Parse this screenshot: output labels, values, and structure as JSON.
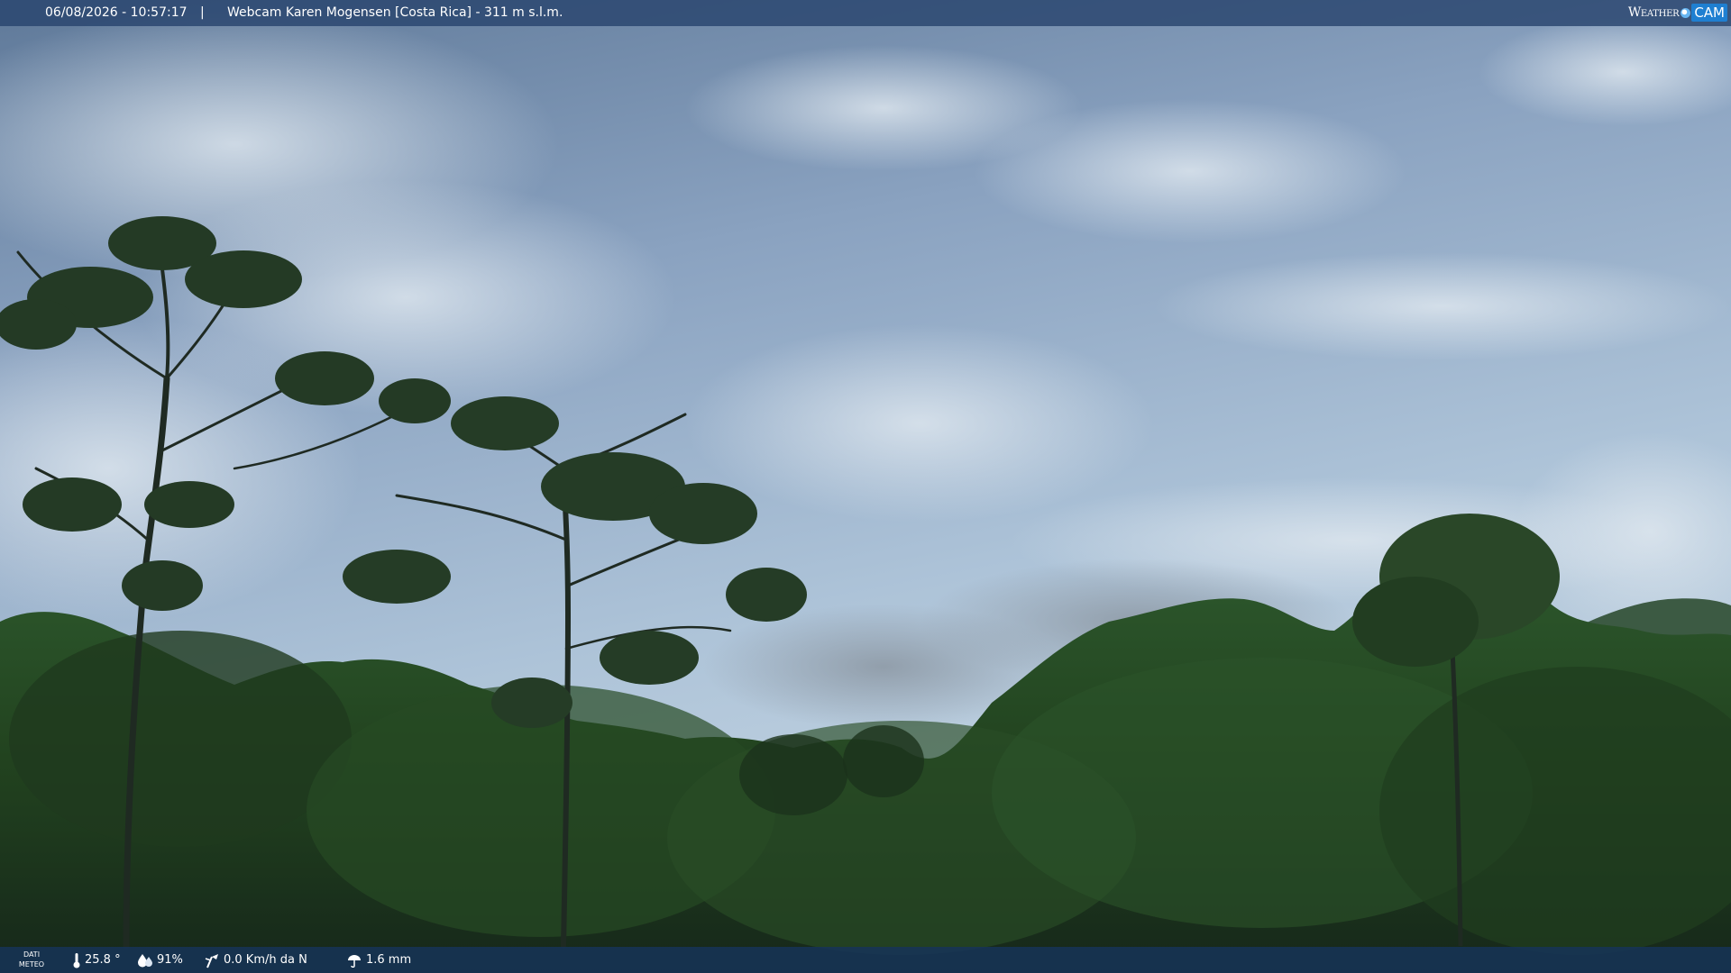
{
  "top_bar": {
    "datetime": "06/08/2026 - 10:57:17",
    "separator": "|",
    "title": "Webcam Karen Mogensen [Costa Rica] - 311 m s.l.m."
  },
  "logo": {
    "word1": "Weather",
    "word2": "CAM",
    "icon": "camera-lens-icon"
  },
  "bottom_bar": {
    "meteo_label_line1": "DATI",
    "meteo_label_line2": "METEO",
    "temperature": "25.8 °",
    "humidity": "91%",
    "wind": "0.0 Km/h da N",
    "rain": "1.6 mm",
    "icons": {
      "temperature": "thermometer-icon",
      "humidity": "drop-icon",
      "wind": "wind-vane-icon",
      "rain": "rain-icon"
    }
  },
  "colors": {
    "top_bar": "#284470",
    "bottom_bar": "#163458",
    "sky_top": "#6f88aa",
    "sky_bottom": "#b9cde0",
    "forest_dark": "#172a17",
    "forest_mid": "#2f5a2b"
  }
}
